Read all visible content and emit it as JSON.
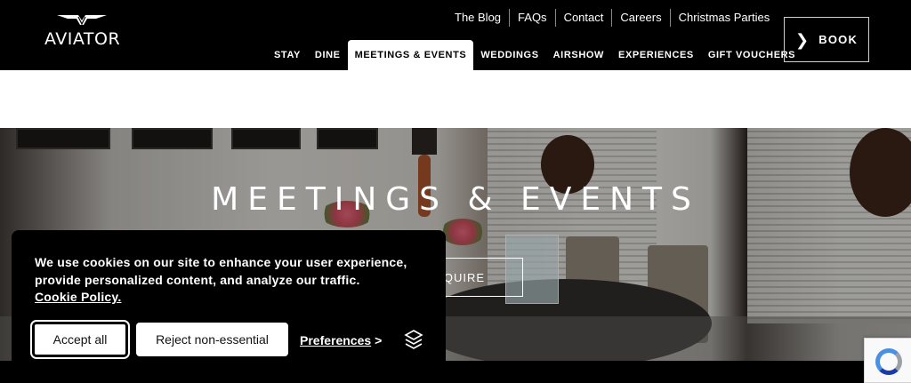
{
  "header": {
    "logo_text": "AVIATOR",
    "top_links": [
      "The Blog",
      "FAQs",
      "Contact",
      "Careers",
      "Christmas Parties"
    ],
    "nav": [
      "STAY",
      "DINE",
      "MEETINGS & EVENTS",
      "WEDDINGS",
      "AIRSHOW",
      "EXPERIENCES",
      "GIFT VOUCHERS"
    ],
    "active_nav": "MEETINGS & EVENTS",
    "book_label": "BOOK"
  },
  "hero": {
    "title": "MEETINGS & EVENTS",
    "enquire_label": "ENQUIRE"
  },
  "cookie_banner": {
    "message": "We use cookies on our site to enhance your user experience, provide personalized content, and analyze our traffic.",
    "policy_link": "Cookie Policy.",
    "accept_label": "Accept all",
    "reject_label": "Reject non-essential",
    "preferences_label": "Preferences",
    "preferences_chevron": ">"
  },
  "icons": {
    "book": "chevron-right-icon",
    "logo": "wings-icon",
    "cookie_provider": "cookie-provider-icon",
    "recaptcha": "recaptcha-icon"
  },
  "colors": {
    "header_bg": "#000000",
    "banner_bg": "#000000",
    "button_bg": "#ffffff"
  }
}
